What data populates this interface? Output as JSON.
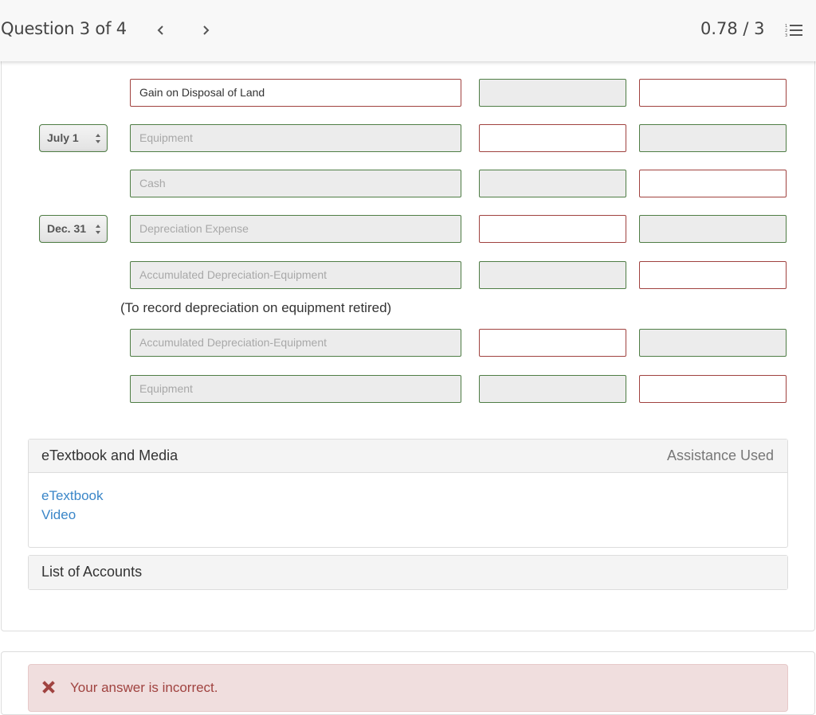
{
  "header": {
    "question_label": "Question 3 of 4",
    "prev_icon": "chevron-left-icon",
    "next_icon": "chevron-right-icon",
    "score": "0.78 / 3",
    "list_icon": "numbered-list-icon"
  },
  "journal": {
    "rows": [
      {
        "date": "",
        "account": "Gain on Disposal of Land",
        "account_status": "incorrect",
        "debit": "",
        "debit_status": "correct",
        "credit": "",
        "credit_status": "incorrect"
      },
      {
        "date": "July 1",
        "account": "Equipment",
        "account_status": "correct",
        "debit": "",
        "debit_status": "incorrect",
        "credit": "",
        "credit_status": "correct"
      },
      {
        "date": "",
        "account": "Cash",
        "account_status": "correct",
        "debit": "",
        "debit_status": "correct",
        "credit": "",
        "credit_status": "incorrect"
      },
      {
        "date": "Dec. 31",
        "account": "Depreciation Expense",
        "account_status": "correct",
        "debit": "",
        "debit_status": "incorrect",
        "credit": "",
        "credit_status": "correct"
      },
      {
        "date": "",
        "account": "Accumulated Depreciation-Equipment",
        "account_status": "correct",
        "debit": "",
        "debit_status": "correct",
        "credit": "",
        "credit_status": "incorrect"
      },
      {
        "date": "",
        "account": "Accumulated Depreciation-Equipment",
        "account_status": "correct",
        "debit": "",
        "debit_status": "incorrect",
        "credit": "",
        "credit_status": "correct"
      },
      {
        "date": "",
        "account": "Equipment",
        "account_status": "correct",
        "debit": "",
        "debit_status": "correct",
        "credit": "",
        "credit_status": "incorrect"
      }
    ],
    "memo": "(To record depreciation on equipment retired)"
  },
  "etextbook_panel": {
    "title": "eTextbook and Media",
    "status": "Assistance Used",
    "links": [
      "eTextbook",
      "Video"
    ]
  },
  "accounts_panel": {
    "title": "List of Accounts"
  },
  "feedback": {
    "icon": "x-icon",
    "message": "Your answer is incorrect."
  },
  "colors": {
    "correct_border": "#4f7d45",
    "incorrect_border": "#a0423f",
    "link": "#3a86c8",
    "alert_bg": "#f0dede",
    "alert_text": "#a04340"
  }
}
